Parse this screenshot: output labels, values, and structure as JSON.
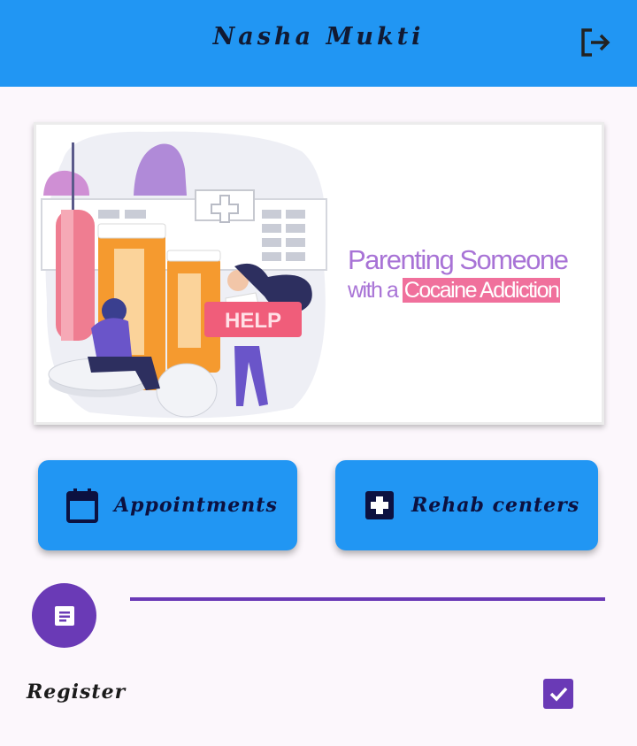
{
  "appbar": {
    "title": "Nasha Mukti",
    "logout_icon": "logout-icon"
  },
  "banner": {
    "line1": "Parenting Someone",
    "line2_prefix": "with a ",
    "line2_highlight": "Cocaine Addiction",
    "sign_text": "HELP"
  },
  "actions": {
    "appointments": {
      "label": "Appointments",
      "icon": "calendar-icon"
    },
    "rehab": {
      "label": "Rehab centers",
      "icon": "medical-cross-icon"
    }
  },
  "stepper": {
    "step_icon": "document-icon",
    "register_label": "Register",
    "checked": true
  },
  "colors": {
    "appbar": "#2196f3",
    "accent": "#6a3ab6",
    "background": "#fcf7fc",
    "highlight": "#f0709c"
  }
}
